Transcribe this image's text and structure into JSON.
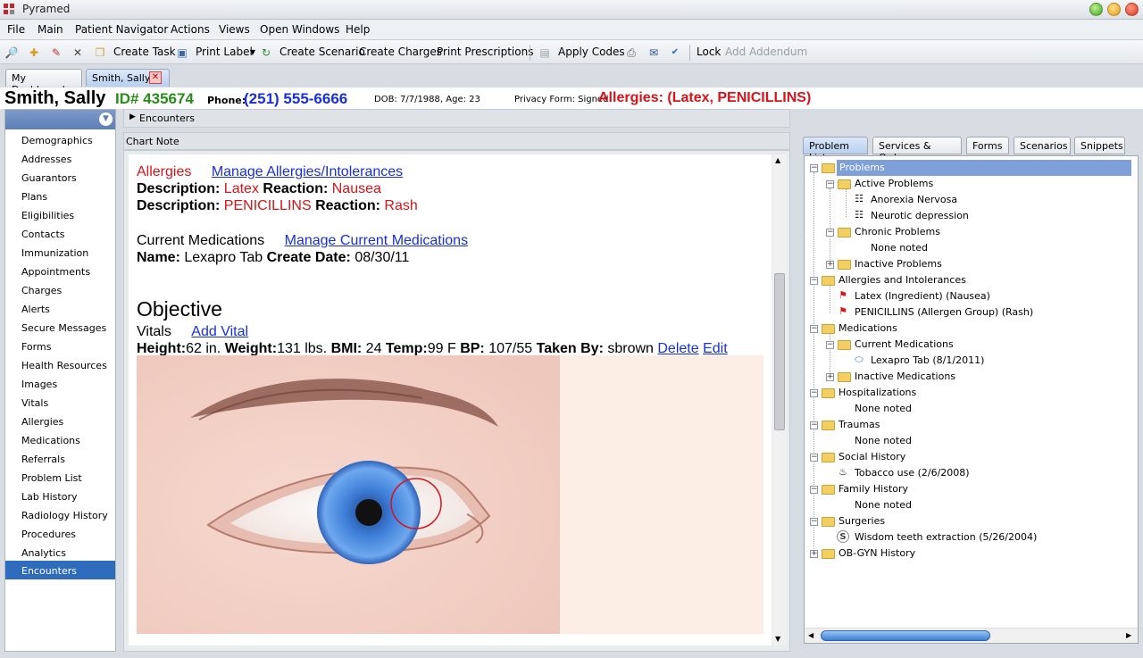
{
  "window": {
    "title": "Pyramed"
  },
  "menu": [
    "File",
    "Main",
    "Patient Navigator",
    "Actions",
    "Views",
    "Open Windows",
    "Help"
  ],
  "toolbar": {
    "create_task": "Create Task",
    "print_label": "Print Label",
    "create_scenario": "Create Scenario",
    "create_charges": "Create Charges",
    "print_prescriptions": "Print Prescriptions",
    "apply_codes": "Apply Codes",
    "lock": "Lock",
    "add_addendum": "Add Addendum"
  },
  "tabs": {
    "dashboard": "My Dashboard",
    "patient": "Smith, Sally"
  },
  "patient": {
    "name": "Smith, Sally",
    "id": "ID# 435674",
    "phone_label": "Phone:",
    "phone": "(251) 555-6666",
    "dob": "DOB: 7/7/1988, Age: 23",
    "privacy": "Privacy Form:  Signed",
    "allergies": "Allergies: (Latex, PENICILLINS)"
  },
  "sidebar": {
    "items": [
      "Demographics",
      "Addresses",
      "Guarantors",
      "Plans",
      "Eligibilities",
      "Contacts",
      "Immunization",
      "Appointments",
      "Charges",
      "Alerts",
      "Secure Messages",
      "Forms",
      "Health Resources",
      "Images",
      "Vitals",
      "Allergies",
      "Medications",
      "Referrals",
      "Problem List",
      "Lab History",
      "Radiology History",
      "Procedures",
      "Analytics",
      "Encounters"
    ],
    "selected": "Encounters"
  },
  "center": {
    "encounters_label": "Encounters",
    "chart_note_label": "Chart Note",
    "allergies_heading": "Allergies",
    "manage_allergies": "Manage Allergies/Intolerances",
    "description_label": "Description:",
    "reaction_label": "Reaction:",
    "allergy1": {
      "desc": "Latex",
      "reaction": "Nausea"
    },
    "allergy2": {
      "desc": "PENICILLINS",
      "reaction": "Rash"
    },
    "meds_heading": "Current Medications",
    "manage_meds": "Manage Current Medications",
    "name_label": "Name:",
    "med_name": "Lexapro Tab",
    "create_date_label": "Create Date:",
    "med_date": "08/30/11",
    "objective": "Objective",
    "vitals": "Vitals",
    "add_vital": "Add Vital",
    "height_label": "Height:",
    "height": "62 in.",
    "weight_label": "Weight:",
    "weight": "131 lbs.",
    "bmi_label": "BMI:",
    "bmi": "24",
    "temp_label": "Temp:",
    "temp": "99 F",
    "bp_label": "BP:",
    "bp": "107/55",
    "taken_by_label": "Taken By:",
    "taken_by": "sbrown",
    "delete": "Delete",
    "edit": "Edit"
  },
  "right_tabs": [
    "Problem List",
    "Services & Orders",
    "Forms",
    "Scenarios",
    "Snippets"
  ],
  "tree": {
    "problems": "Problems",
    "active": "Active Problems",
    "active_items": [
      "Anorexia Nervosa",
      "Neurotic depression"
    ],
    "chronic": "Chronic Problems",
    "none_noted": "None noted",
    "inactive": "Inactive Problems",
    "allergies": "Allergies and Intolerances",
    "allergy_items": [
      "Latex (Ingredient) (Nausea)",
      "PENICILLINS (Allergen Group) (Rash)"
    ],
    "medications": "Medications",
    "current_meds": "Current Medications",
    "med_item": "Lexapro Tab (8/1/2011)",
    "inactive_meds": "Inactive Medications",
    "hospitalizations": "Hospitalizations",
    "traumas": "Traumas",
    "social": "Social History",
    "social_item": "Tobacco use (2/6/2008)",
    "family": "Family History",
    "surgeries": "Surgeries",
    "surgery_item": "Wisdom teeth extraction (5/26/2004)",
    "obgyn": "OB-GYN History"
  },
  "colors": {
    "accent": "#2f6cbd",
    "alert_red": "#d6141a",
    "id_green": "#2a8a1a",
    "phone_blue": "#1a2fd6"
  }
}
